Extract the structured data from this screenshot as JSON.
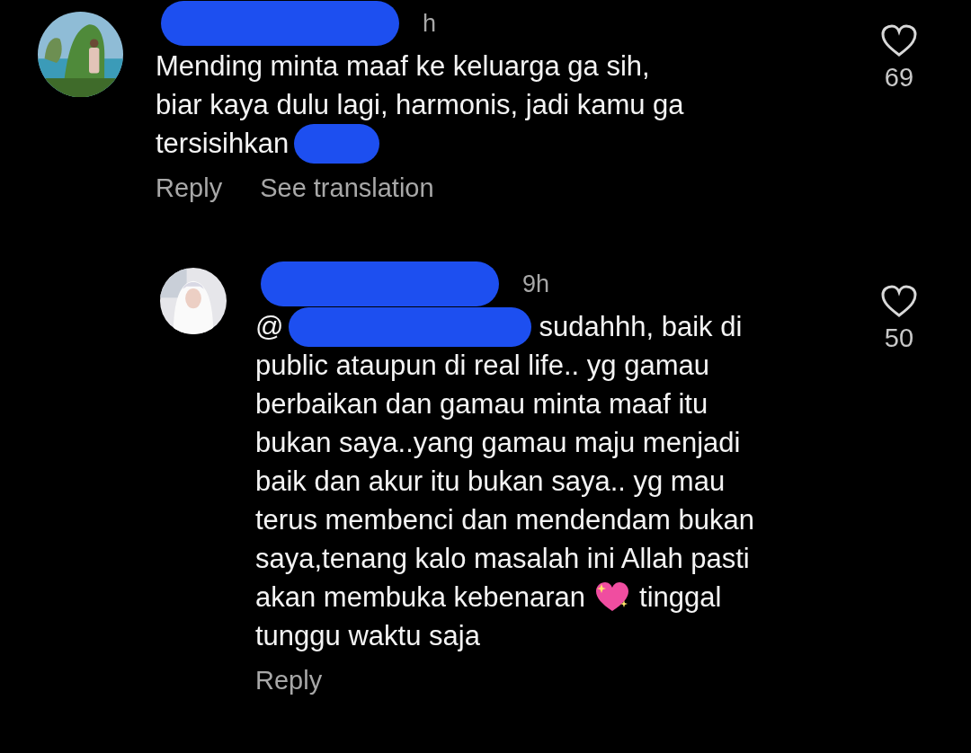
{
  "comments": [
    {
      "avatar": {
        "kind": "picture"
      },
      "header": [
        {
          "kind": "redaction"
        },
        {
          "kind": "text",
          "text": "h"
        }
      ],
      "lines": [
        [
          {
            "kind": "text",
            "text": "Mending minta maaf ke keluarga ga sih,"
          }
        ],
        [
          {
            "kind": "text",
            "text": "biar kaya dulu lagi, harmonis, jadi kamu ga"
          }
        ],
        [
          {
            "kind": "text",
            "text": "tersisihkan"
          },
          {
            "kind": "redaction"
          }
        ]
      ],
      "actions": [
        "Reply",
        "See translation"
      ],
      "likes": "69",
      "liked": false
    },
    {
      "avatar": {
        "kind": "picture"
      },
      "header": [
        {
          "kind": "redaction"
        },
        {
          "kind": "text",
          "text": "9h"
        }
      ],
      "lines": [
        [
          {
            "kind": "text",
            "text": "@"
          },
          {
            "kind": "redaction"
          },
          {
            "kind": "text",
            "text": "sudahhh, baik di"
          }
        ],
        [
          {
            "kind": "text",
            "text": "public ataupun di real life.. yg gamau"
          }
        ],
        [
          {
            "kind": "text",
            "text": "berbaikan dan gamau minta maaf itu"
          }
        ],
        [
          {
            "kind": "text",
            "text": "bukan saya..yang gamau maju menjadi"
          }
        ],
        [
          {
            "kind": "text",
            "text": "baik dan akur itu bukan saya.. yg mau"
          }
        ],
        [
          {
            "kind": "text",
            "text": "terus membenci dan mendendam bukan"
          }
        ],
        [
          {
            "kind": "text",
            "text": "saya,tenang kalo masalah ini Allah pasti"
          }
        ],
        [
          {
            "kind": "text",
            "text": "akan membuka kebenaran"
          },
          {
            "kind": "heart"
          },
          {
            "kind": "text",
            "text": "tinggal"
          }
        ],
        [
          {
            "kind": "text",
            "text": "tunggu waktu saja"
          }
        ]
      ],
      "actions": [
        "Reply"
      ],
      "likes": "50",
      "liked": false
    }
  ]
}
